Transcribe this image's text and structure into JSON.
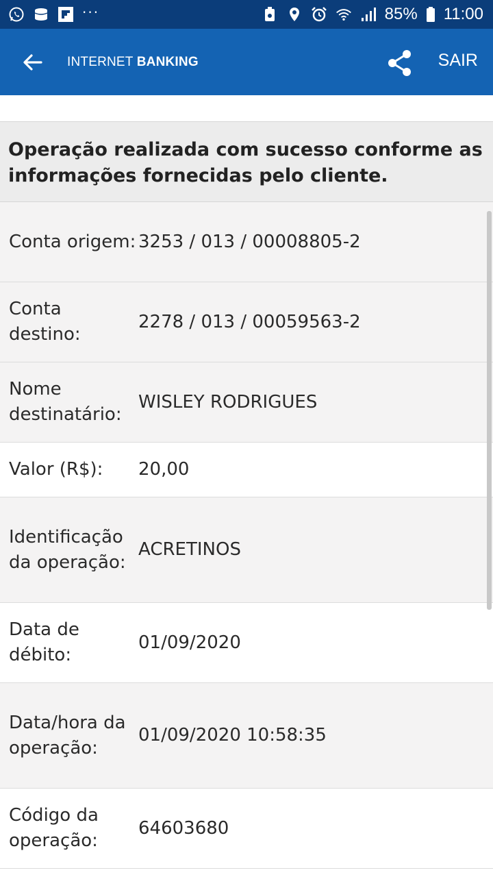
{
  "status_bar": {
    "battery": "85%",
    "time": "11:00",
    "more": "···",
    "icons": [
      "whatsapp-icon",
      "cloud-icon",
      "flipboard-icon",
      "more-icon",
      "battery-saver-icon",
      "location-icon",
      "alarm-icon",
      "wifi-icon",
      "signal-icon",
      "battery-icon"
    ]
  },
  "app_bar": {
    "title_light": "INTERNET ",
    "title_bold": "BANKING",
    "exit_label": "SAIR",
    "color": "#1463b3"
  },
  "message": "Operação realizada com sucesso conforme as informações fornecidas pelo cliente.",
  "details": [
    {
      "label": "Conta origem:",
      "value": "3253 / 013 / 00008805-2"
    },
    {
      "label": "Conta destino:",
      "value": "2278 / 013 / 00059563-2"
    },
    {
      "label": "Nome destinatário:",
      "value": "WISLEY RODRIGUES"
    },
    {
      "label": "Valor (R$):",
      "value": "20,00"
    },
    {
      "label": "Identificação da operação:",
      "value": "ACRETINOS"
    },
    {
      "label": "Data de débito:",
      "value": "01/09/2020"
    },
    {
      "label": "Data/hora da operação:",
      "value": "01/09/2020 10:58:35"
    },
    {
      "label": "Código da operação:",
      "value": "64603680"
    }
  ]
}
